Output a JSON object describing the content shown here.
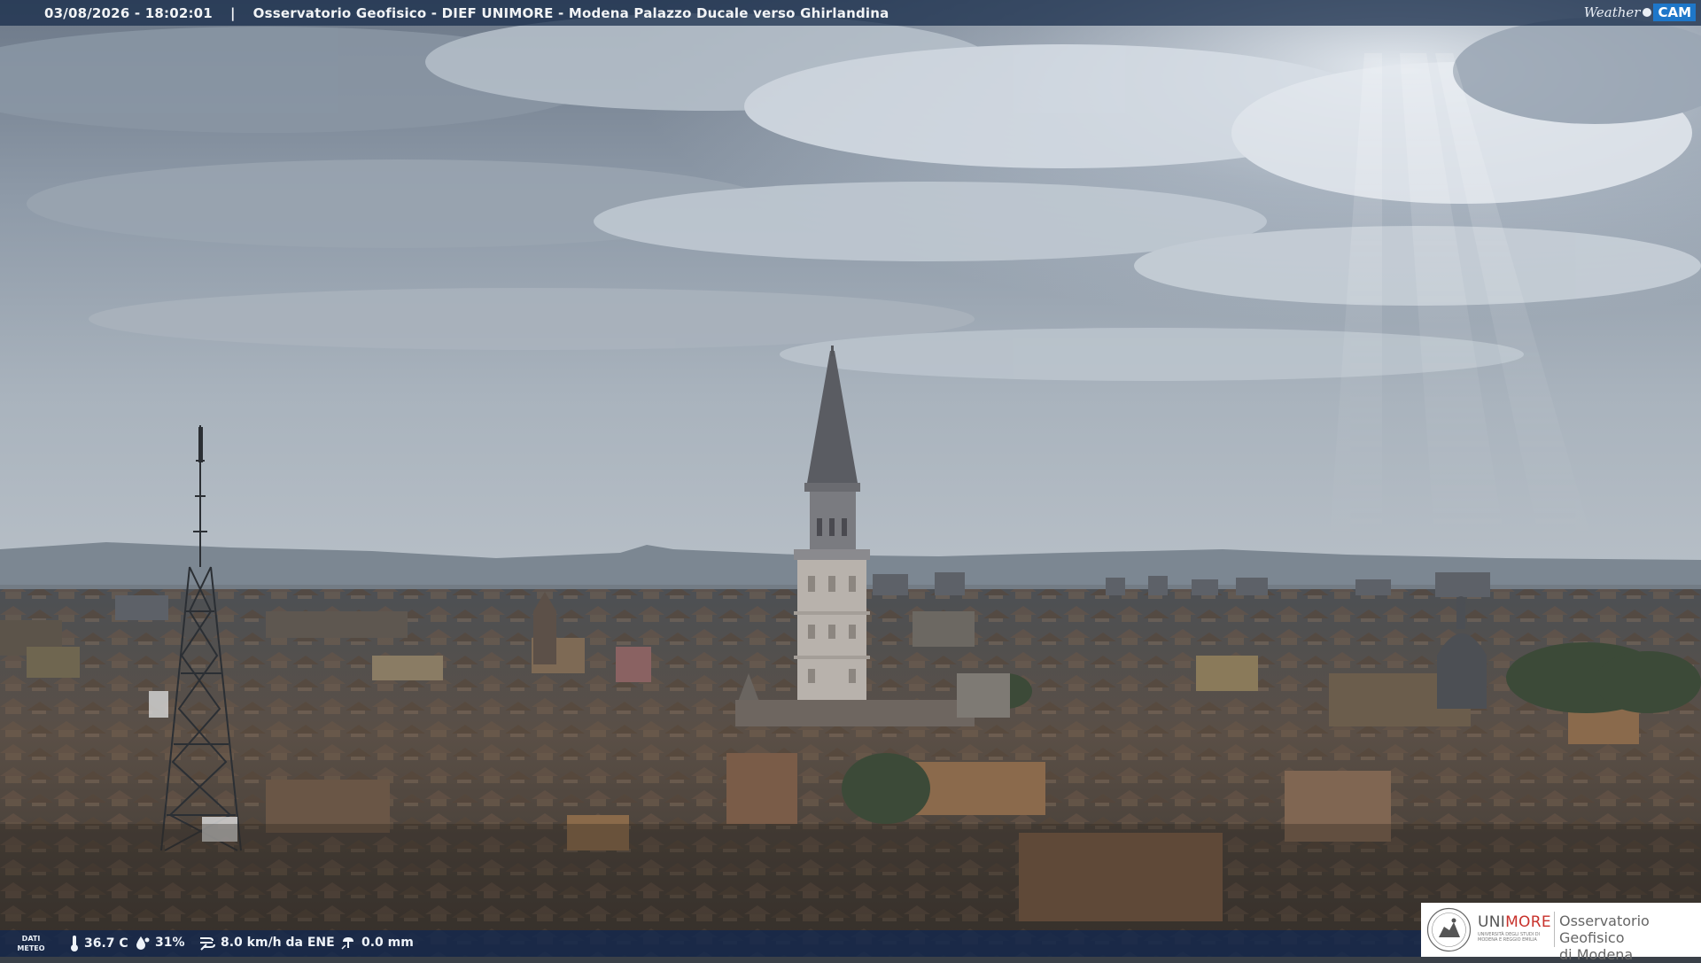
{
  "header": {
    "datetime": "03/08/2026 - 18:02:01",
    "separator": "|",
    "camera_title": "Osservatorio Geofisico - DIEF UNIMORE - Modena Palazzo Ducale verso Ghirlandina"
  },
  "weathercam_logo": {
    "weather": "Weather",
    "cam": "CAM",
    "dot_icon": "circle-icon"
  },
  "meteo": {
    "label_line1": "DATI",
    "label_line2": "METEO",
    "temperature": "36.7 C",
    "humidity": "31%",
    "wind": "8.0 km/h da ENE",
    "rain": "0.0 mm",
    "icons": [
      "thermometer-icon",
      "humidity-drop-icon",
      "wind-icon",
      "rain-icon"
    ]
  },
  "institution": {
    "name_part1": "UNI",
    "name_part2": "MORE",
    "subline": "UNIVERSITÀ DEGLI STUDI DI MODENA E REGGIO EMILIA",
    "observatory_line1": "Osservatorio Geofisico",
    "observatory_line2": "di Modena",
    "seal_icon": "university-seal-icon",
    "highlight_color": "#c8322c"
  }
}
